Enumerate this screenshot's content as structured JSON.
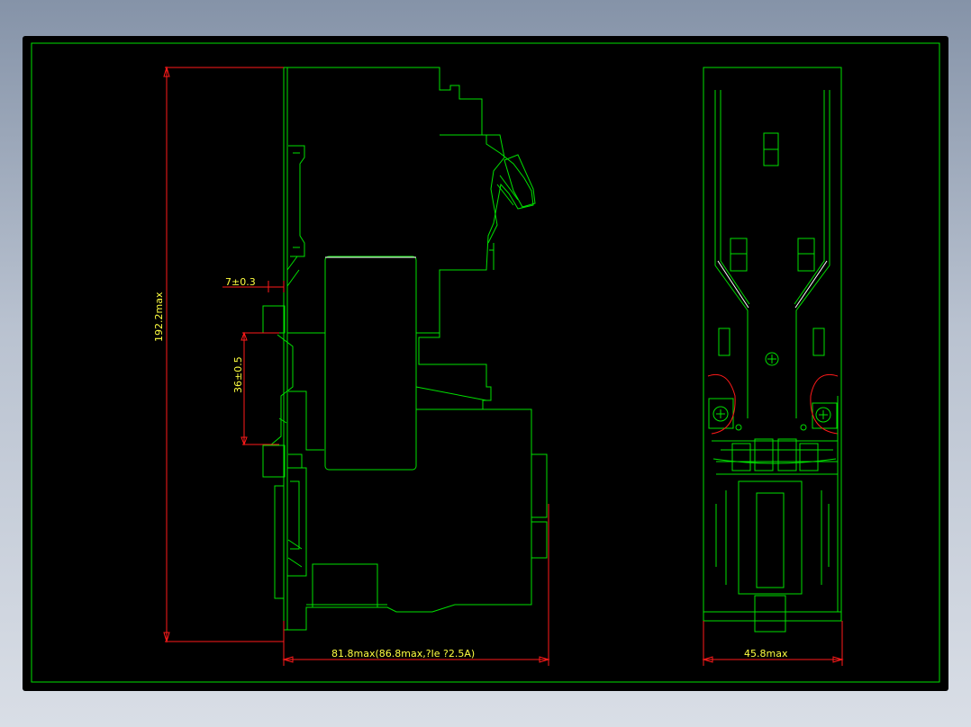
{
  "colors": {
    "background": "#000000",
    "geometry": "#00e000",
    "dimension_line": "#ff1a1a",
    "dimension_text": "#ffff40",
    "highlight": "#ffffff"
  },
  "dimensions": {
    "height": "192.2max",
    "offset": "7±0.3",
    "rail": "36±0.5",
    "depth": "81.8max(86.8max,?Ie ?2.5A)",
    "width": "45.8max"
  }
}
